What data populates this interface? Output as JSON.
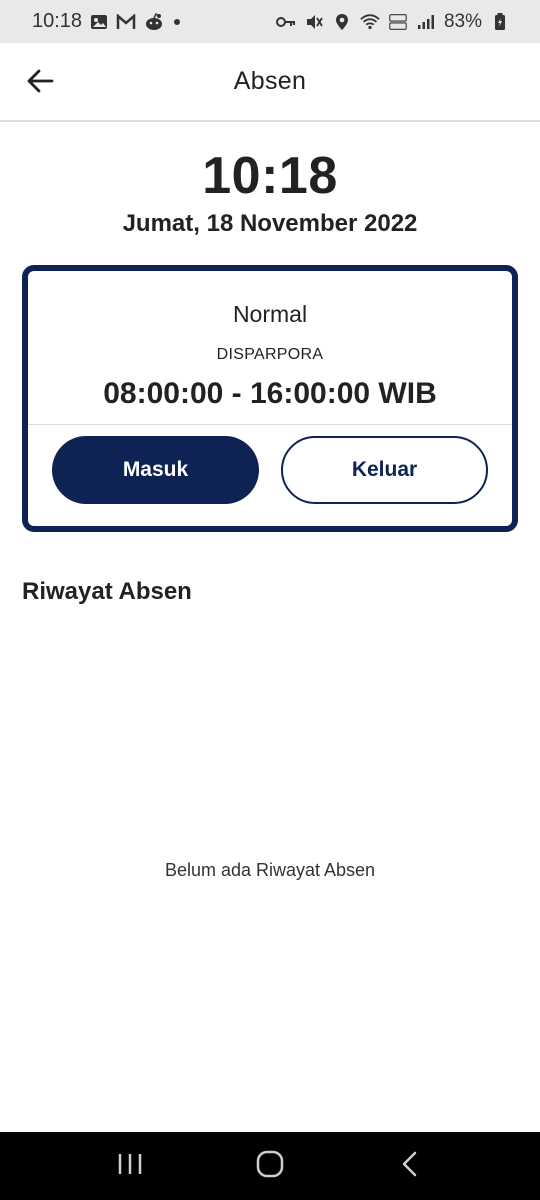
{
  "status_bar": {
    "time": "10:18",
    "left_icons": [
      "gallery-icon",
      "gmail-icon",
      "reddit-icon",
      "dot-icon"
    ],
    "right_icons": [
      "vpn-key-icon",
      "mute-icon",
      "location-icon",
      "wifi-icon",
      "volte-icon",
      "signal-icon"
    ],
    "battery": "83%"
  },
  "appbar": {
    "title": "Absen",
    "back_icon": "arrow-left-icon"
  },
  "clock": {
    "time": "10:18",
    "date": "Jumat, 18 November 2022"
  },
  "shift_card": {
    "type": "Normal",
    "organization": "DISPARPORA",
    "hours": "08:00:00 - 16:00:00 WIB",
    "border_color": "#0f2254",
    "buttons": {
      "check_in": "Masuk",
      "check_out": "Keluar"
    }
  },
  "history": {
    "title": "Riwayat Absen",
    "empty_message": "Belum ada Riwayat Absen"
  },
  "nav_bar": {
    "icons": [
      "recent-apps-icon",
      "home-icon",
      "back-icon"
    ]
  }
}
